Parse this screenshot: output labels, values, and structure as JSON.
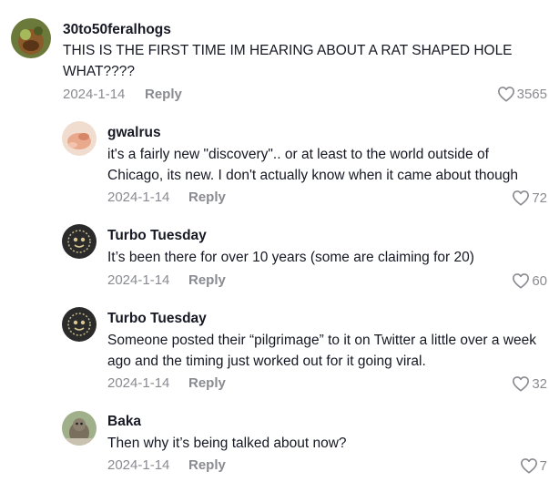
{
  "comments": [
    {
      "username": "30to50feralhogs",
      "text": "THIS IS THE FIRST TIME IM HEARING ABOUT A RAT SHAPED HOLE WHAT????",
      "date": "2024-1-14",
      "reply_label": "Reply",
      "likes": "3565"
    },
    {
      "username": "gwalrus",
      "text": "it's a fairly new \"discovery\".. or at least to the world outside of Chicago, its new. I don't actually know when it came about though",
      "date": "2024-1-14",
      "reply_label": "Reply",
      "likes": "72"
    },
    {
      "username": "Turbo Tuesday",
      "text": "It’s been there for over 10 years (some are claiming for 20)",
      "date": "2024-1-14",
      "reply_label": "Reply",
      "likes": "60"
    },
    {
      "username": "Turbo Tuesday",
      "text": "Someone posted their “pilgrimage” to it on Twitter a little over a week ago and the timing just worked out for it going viral.",
      "date": "2024-1-14",
      "reply_label": "Reply",
      "likes": "32"
    },
    {
      "username": "Baka",
      "text": "Then why it’s being talked about now?",
      "date": "2024-1-14",
      "reply_label": "Reply",
      "likes": "7"
    }
  ],
  "colors": {
    "text_primary": "#161823",
    "text_secondary": "#8a8b91",
    "background": "#ffffff"
  },
  "icons": {
    "like": "heart-outline-icon",
    "avatar": "user-avatar"
  }
}
